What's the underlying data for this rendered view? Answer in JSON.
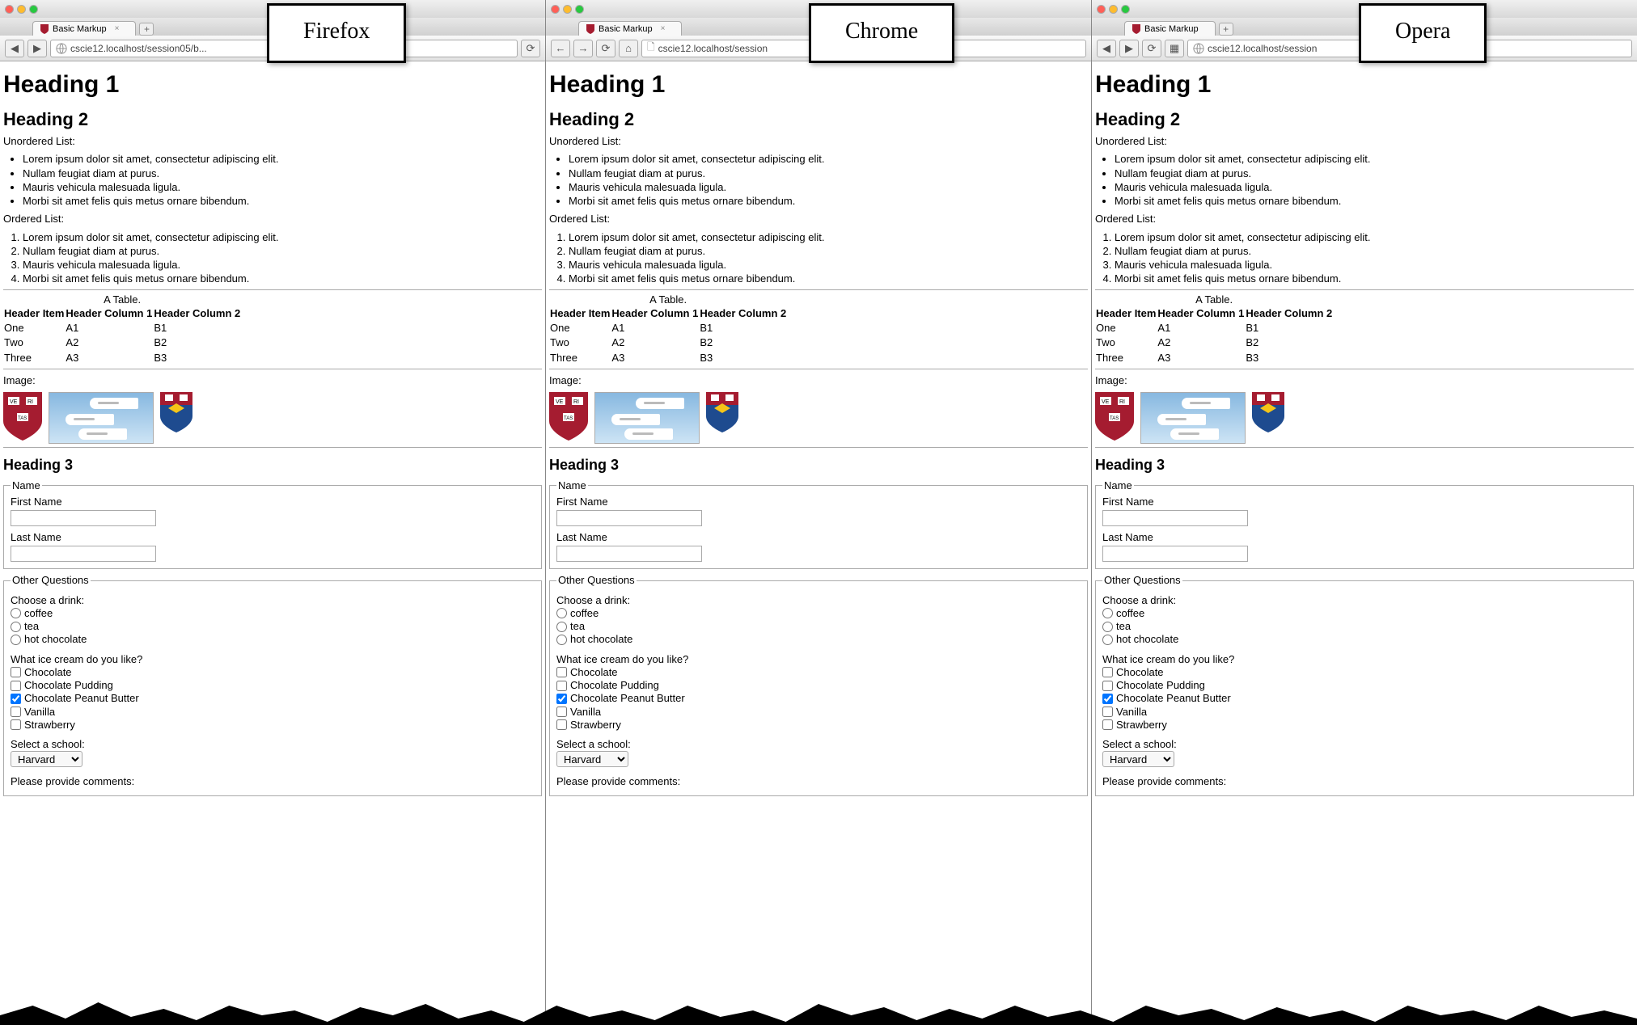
{
  "labels": {
    "firefox": "Firefox",
    "chrome": "Chrome",
    "opera": "Opera"
  },
  "browsers": [
    {
      "name": "firefox",
      "tab_title": "Basic Markup",
      "url": "cscie12.localhost/session05/b..."
    },
    {
      "name": "chrome",
      "tab_title": "Basic Markup",
      "url": "cscie12.localhost/session"
    },
    {
      "name": "opera",
      "tab_title": "Basic Markup",
      "url": "cscie12.localhost/session"
    }
  ],
  "page": {
    "h1": "Heading 1",
    "h2": "Heading 2",
    "h3": "Heading 3",
    "ul_label": "Unordered List:",
    "ol_label": "Ordered List:",
    "list_items": [
      "Lorem ipsum dolor sit amet, consectetur adipiscing elit.",
      "Nullam feugiat diam at purus.",
      "Mauris vehicula malesuada ligula.",
      "Morbi sit amet felis quis metus ornare bibendum."
    ],
    "table": {
      "caption": "A Table.",
      "headers": [
        "Header Item",
        "Header Column 1",
        "Header Column 2"
      ],
      "rows": [
        [
          "One",
          "A1",
          "B1"
        ],
        [
          "Two",
          "A2",
          "B2"
        ],
        [
          "Three",
          "A3",
          "B3"
        ]
      ]
    },
    "image_label": "Image:",
    "form": {
      "name_legend": "Name",
      "first_name_label": "First Name",
      "last_name_label": "Last Name",
      "other_legend": "Other Questions",
      "drink_label": "Choose a drink:",
      "drinks": [
        "coffee",
        "tea",
        "hot chocolate"
      ],
      "icecream_label": "What ice cream do you like?",
      "icecreams": [
        {
          "label": "Chocolate",
          "checked": false
        },
        {
          "label": "Chocolate Pudding",
          "checked": false
        },
        {
          "label": "Chocolate Peanut Butter",
          "checked": true
        },
        {
          "label": "Vanilla",
          "checked": false
        },
        {
          "label": "Strawberry",
          "checked": false
        }
      ],
      "school_label": "Select a school:",
      "school_selected": "Harvard",
      "comments_label": "Please provide comments:"
    }
  }
}
